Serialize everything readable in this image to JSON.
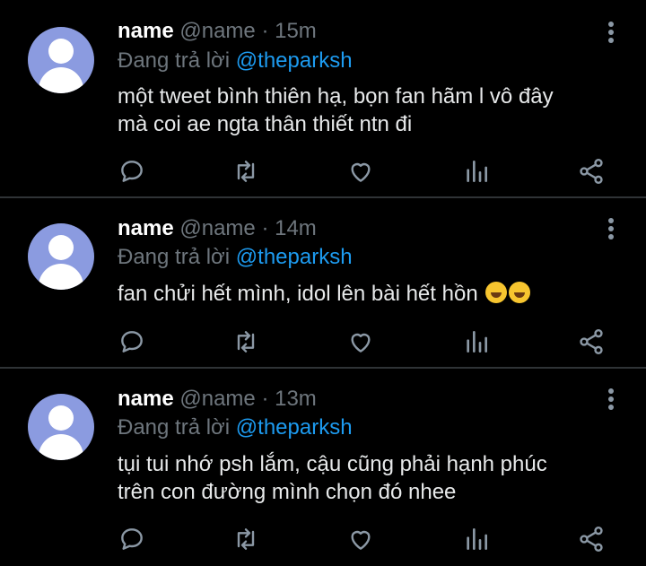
{
  "tweets": [
    {
      "name": "name",
      "meta": "@name · 15m",
      "reply_prefix": "Đang trả lời",
      "reply_handle": "@theparksh",
      "text": "một tweet bình thiên hạ, bọn fan hãm l vô đây\nmà coi ae ngta thân thiết ntn đi",
      "emojis": []
    },
    {
      "name": "name",
      "meta": "@name · 14m",
      "reply_prefix": "Đang trả lời",
      "reply_handle": "@theparksh",
      "text": "fan chửi hết mình, idol lên bài hết hồn",
      "emojis": [
        "rolling-on-floor-laughing",
        "rolling-on-floor-laughing"
      ]
    },
    {
      "name": "name",
      "meta": "@name · 13m",
      "reply_prefix": "Đang trả lời",
      "reply_handle": "@theparksh",
      "text": "tụi tui nhớ psh lắm, cậu cũng phải hạnh phúc\ntrên con đường mình chọn đó nhee",
      "emojis": []
    }
  ],
  "icons": {
    "actions": [
      "reply-icon",
      "retweet-icon",
      "like-icon",
      "analytics-icon",
      "share-icon"
    ],
    "more": "more-vertical-icon"
  },
  "colors": {
    "background": "#000000",
    "name": "#ffffff",
    "meta": "#6e767d",
    "handle": "#1d9bf0",
    "text": "#e7e9ea",
    "icon": "#8b98a5",
    "avatar": "#8b9be0",
    "divider": "#2f3336"
  }
}
